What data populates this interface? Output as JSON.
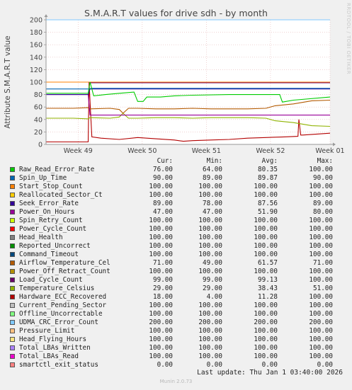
{
  "chart_data": {
    "type": "line",
    "title": "S.M.A.R.T values for drive sdh - by month",
    "ylabel": "Attribute S.M.A.R.T value",
    "side_label": "RRDTOOL / TOBI OETIKER",
    "ylim": [
      0,
      200
    ],
    "yticks": [
      0,
      20,
      40,
      60,
      80,
      100,
      120,
      140,
      160,
      180,
      200
    ],
    "xlim": [
      0,
      31
    ],
    "xticks": [
      {
        "label": "Week 49",
        "x": 3.5
      },
      {
        "label": "Week 50",
        "x": 10.5
      },
      {
        "label": "Week 51",
        "x": 17.5
      },
      {
        "label": "Week 52",
        "x": 24.5
      },
      {
        "label": "Week 01",
        "x": 31
      }
    ],
    "grid": true,
    "legend_columns": [
      "Cur:",
      "Min:",
      "Avg:",
      "Max:"
    ],
    "series": [
      {
        "name": "Raw_Read_Error_Rate",
        "color": "#00cc00",
        "cur": "76.00",
        "min": "64.00",
        "avg": "80.35",
        "max": "100.00",
        "x": [
          0,
          4.6,
          4.8,
          5.2,
          6.5,
          8,
          9.6,
          10,
          10.6,
          11,
          12.5,
          14,
          16,
          20,
          24,
          25.5,
          25.8,
          27,
          31
        ],
        "y": [
          82,
          82,
          100,
          78,
          80,
          82,
          84,
          69,
          69,
          76,
          76,
          78,
          79,
          80,
          80,
          80,
          68,
          71,
          76
        ]
      },
      {
        "name": "Spin_Up_Time",
        "color": "#0066b3",
        "cur": "90.00",
        "min": "89.00",
        "avg": "89.87",
        "max": "90.00",
        "x": [
          0,
          4.6,
          5,
          31
        ],
        "y": [
          89,
          89,
          90,
          90
        ]
      },
      {
        "name": "Start_Stop_Count",
        "color": "#ff8000",
        "cur": "100.00",
        "min": "100.00",
        "avg": "100.00",
        "max": "100.00",
        "x": [
          0,
          31
        ],
        "y": [
          100,
          100
        ]
      },
      {
        "name": "Reallocated_Sector_Ct",
        "color": "#ffcc00",
        "cur": "100.00",
        "min": "100.00",
        "avg": "100.00",
        "max": "100.00",
        "x": [
          0,
          31
        ],
        "y": [
          100,
          100
        ]
      },
      {
        "name": "Seek_Error_Rate",
        "color": "#330099",
        "cur": "89.00",
        "min": "78.00",
        "avg": "87.56",
        "max": "89.00",
        "x": [
          0,
          4.6,
          4.8,
          31
        ],
        "y": [
          80,
          80,
          89,
          89
        ]
      },
      {
        "name": "Power_On_Hours",
        "color": "#990099",
        "cur": "47.00",
        "min": "47.00",
        "avg": "51.90",
        "max": "80.00",
        "x": [
          0,
          4.6,
          4.8,
          31
        ],
        "y": [
          80,
          80,
          47,
          47
        ]
      },
      {
        "name": "Spin_Retry_Count",
        "color": "#ccff00",
        "cur": "100.00",
        "min": "100.00",
        "avg": "100.00",
        "max": "100.00",
        "x": [
          0,
          31
        ],
        "y": [
          100,
          100
        ]
      },
      {
        "name": "Power_Cycle_Count",
        "color": "#ff0000",
        "cur": "100.00",
        "min": "100.00",
        "avg": "100.00",
        "max": "100.00",
        "x": [
          0,
          31
        ],
        "y": [
          100,
          100
        ]
      },
      {
        "name": "Head_Health",
        "color": "#808080",
        "cur": "100.00",
        "min": "100.00",
        "avg": "100.00",
        "max": "100.00",
        "x": [
          0,
          31
        ],
        "y": [
          100,
          100
        ]
      },
      {
        "name": "Reported_Uncorrect",
        "color": "#008f00",
        "cur": "100.00",
        "min": "100.00",
        "avg": "100.00",
        "max": "100.00",
        "x": [
          0,
          31
        ],
        "y": [
          100,
          100
        ]
      },
      {
        "name": "Command_Timeout",
        "color": "#00487d",
        "cur": "100.00",
        "min": "100.00",
        "avg": "100.00",
        "max": "100.00",
        "x": [
          0,
          31
        ],
        "y": [
          100,
          100
        ]
      },
      {
        "name": "Airflow_Temperature_Cel",
        "color": "#b35a00",
        "cur": "71.00",
        "min": "49.00",
        "avg": "61.57",
        "max": "71.00",
        "x": [
          0,
          3,
          4.6,
          4.8,
          7,
          8,
          8.4,
          9,
          10,
          12,
          14,
          16,
          18,
          20,
          22,
          24,
          25,
          27,
          29,
          31
        ],
        "y": [
          58,
          58,
          59,
          57,
          58,
          56,
          50,
          58,
          58,
          57,
          57,
          58,
          57,
          57,
          57,
          58,
          62,
          65,
          70,
          71
        ]
      },
      {
        "name": "Power_Off_Retract_Count",
        "color": "#b38f00",
        "cur": "100.00",
        "min": "100.00",
        "avg": "100.00",
        "max": "100.00",
        "x": [
          0,
          31
        ],
        "y": [
          100,
          100
        ]
      },
      {
        "name": "Load_Cycle_Count",
        "color": "#6b006b",
        "cur": "99.00",
        "min": "99.00",
        "avg": "99.13",
        "max": "100.00",
        "x": [
          0,
          4.6,
          4.8,
          31
        ],
        "y": [
          100,
          100,
          99,
          99
        ]
      },
      {
        "name": "Temperature_Celsius",
        "color": "#8fb300",
        "cur": "29.00",
        "min": "29.00",
        "avg": "38.43",
        "max": "51.00",
        "x": [
          0,
          3,
          4.6,
          4.8,
          7,
          8,
          8.4,
          9,
          10,
          12,
          14,
          16,
          18,
          20,
          22,
          24,
          25,
          27,
          29,
          31
        ],
        "y": [
          42,
          42,
          41,
          43,
          42,
          44,
          50,
          42,
          42,
          43,
          43,
          42,
          43,
          43,
          43,
          42,
          38,
          35,
          30,
          29
        ]
      },
      {
        "name": "Hardware_ECC_Recovered",
        "color": "#b30000",
        "cur": "18.00",
        "min": "4.00",
        "avg": "11.28",
        "max": "100.00",
        "x": [
          0,
          4.6,
          4.7,
          4.9,
          5,
          6,
          8,
          10,
          12,
          14,
          15,
          16,
          18,
          20,
          22,
          24,
          26,
          27.5,
          27.6,
          27.8,
          28,
          29,
          31
        ],
        "y": [
          4,
          4,
          100,
          40,
          12,
          10,
          8,
          11,
          9,
          7,
          5,
          6,
          7,
          8,
          10,
          11,
          12,
          13,
          40,
          15,
          15,
          16,
          18
        ]
      },
      {
        "name": "Current_Pending_Sector",
        "color": "#bebebe",
        "cur": "100.00",
        "min": "100.00",
        "avg": "100.00",
        "max": "100.00",
        "x": [
          0,
          31
        ],
        "y": [
          100,
          100
        ]
      },
      {
        "name": "Offline_Uncorrectable",
        "color": "#80ff80",
        "cur": "100.00",
        "min": "100.00",
        "avg": "100.00",
        "max": "100.00",
        "x": [
          0,
          31
        ],
        "y": [
          100,
          100
        ]
      },
      {
        "name": "UDMA_CRC_Error_Count",
        "color": "#80c9ff",
        "cur": "200.00",
        "min": "200.00",
        "avg": "200.00",
        "max": "200.00",
        "x": [
          0,
          31
        ],
        "y": [
          200,
          200
        ]
      },
      {
        "name": "Pressure_Limit",
        "color": "#ffc080",
        "cur": "100.00",
        "min": "100.00",
        "avg": "100.00",
        "max": "100.00",
        "x": [
          0,
          31
        ],
        "y": [
          100,
          100
        ]
      },
      {
        "name": "Head_Flying_Hours",
        "color": "#ffe680",
        "cur": "100.00",
        "min": "100.00",
        "avg": "100.00",
        "max": "100.00",
        "x": [
          0,
          31
        ],
        "y": [
          100,
          100
        ]
      },
      {
        "name": "Total_LBAs_Written",
        "color": "#aa80ff",
        "cur": "100.00",
        "min": "100.00",
        "avg": "100.00",
        "max": "100.00",
        "x": [
          0,
          31
        ],
        "y": [
          100,
          100
        ]
      },
      {
        "name": "Total_LBAs_Read",
        "color": "#ee00cc",
        "cur": "100.00",
        "min": "100.00",
        "avg": "100.00",
        "max": "100.00",
        "x": [
          0,
          31
        ],
        "y": [
          100,
          100
        ]
      },
      {
        "name": "smartctl_exit_status",
        "color": "#ff8080",
        "cur": "0.00",
        "min": "0.00",
        "avg": "0.00",
        "max": "0.00",
        "x": [
          0,
          31
        ],
        "y": [
          0,
          0
        ]
      }
    ]
  },
  "last_update": "Last update: Thu Jan  1 03:40:00 2026",
  "footer": "Munin 2.0.73"
}
